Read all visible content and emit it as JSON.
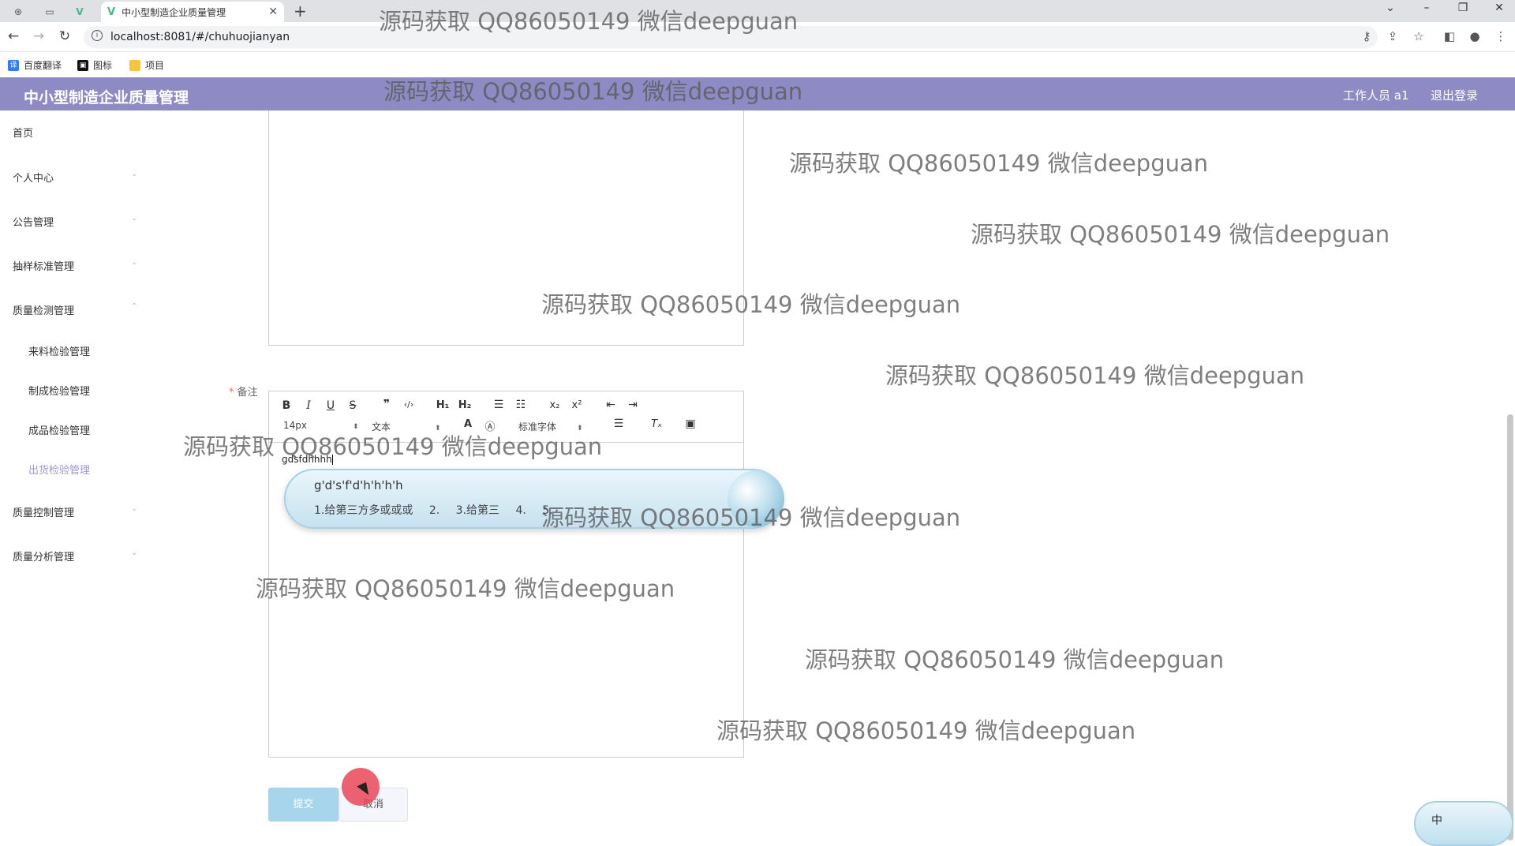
{
  "browser": {
    "tab_title": "中小型制造企业质量管理",
    "url": "localhost:8081/#/chuhuojianyan",
    "bookmarks": [
      {
        "label": "百度翻译",
        "color": "#2e7cf6"
      },
      {
        "label": "图标",
        "color": "#111111"
      },
      {
        "label": "项目",
        "color": "#f6c343"
      }
    ]
  },
  "header": {
    "title": "中小型制造企业质量管理",
    "user": "工作人员 a1",
    "logout": "退出登录",
    "color": "#8e8bc4"
  },
  "sidebar": {
    "items": [
      {
        "label": "首页"
      },
      {
        "label": "个人中心"
      },
      {
        "label": "公告管理"
      },
      {
        "label": "抽样标准管理"
      },
      {
        "label": "质量检测管理"
      },
      {
        "label": "质量控制管理"
      },
      {
        "label": "质量分析管理"
      }
    ],
    "subitems": [
      {
        "label": "来料检验管理"
      },
      {
        "label": "制成检验管理"
      },
      {
        "label": "成品检验管理"
      },
      {
        "label": "出货检验管理"
      }
    ]
  },
  "form": {
    "remark_label": "备注",
    "editor_text": "gdsfdhhhh",
    "toolbar": {
      "size": "14px",
      "paragraph": "文本",
      "font": "标准字体"
    },
    "submit": "提交",
    "cancel": "取消"
  },
  "ime": {
    "composition": "g'd's'f'd'h'h'h'h",
    "candidates": [
      "1.给第三方多或或或",
      "2.",
      "3.给第三",
      "4.",
      "5."
    ],
    "status": "中"
  },
  "watermark": "源码获取 QQ86050149 微信deepguan"
}
